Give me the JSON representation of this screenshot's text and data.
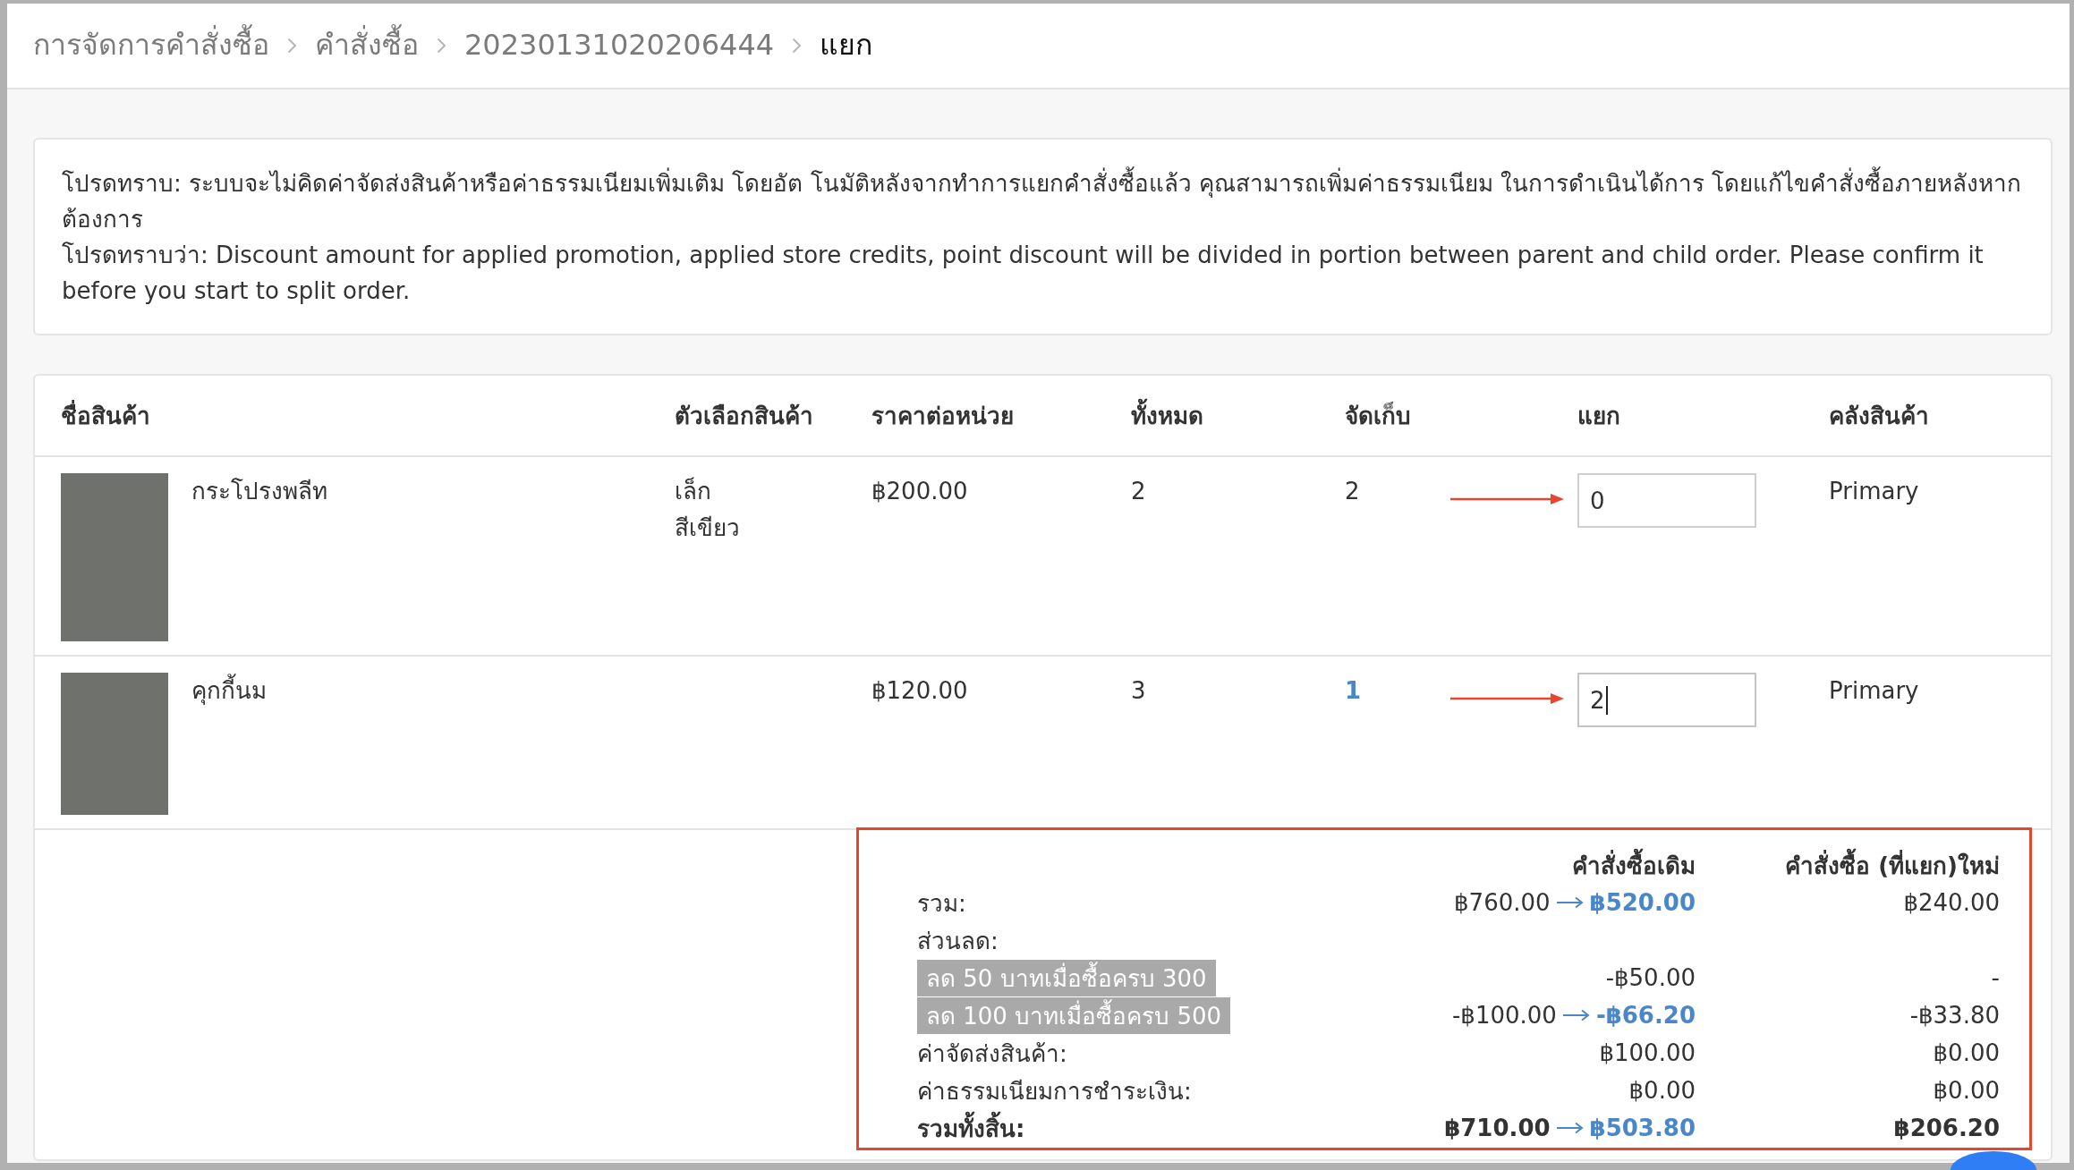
{
  "breadcrumb": [
    {
      "label": "การจัดการคำสั่งซื้อ",
      "current": false
    },
    {
      "label": "คำสั่งซื้อ",
      "current": false
    },
    {
      "label": "20230131020206444",
      "current": false
    },
    {
      "label": "แยก",
      "current": true
    }
  ],
  "notice": [
    "โปรดทราบ: ระบบจะไม่คิดค่าจัดส่งสินค้าหรือค่าธรรมเนียมเพิ่มเติม โดยอัต โนมัติหลังจากทำการแยกคำสั่งซื้อแล้ว คุณสามารถเพิ่มค่าธรรมเนียม ในการดำเนินได้การ โดยแก้ไขคำสั่งซื้อภายหลังหากต้องการ",
    "โปรดทราบว่า: Discount amount for applied promotion, applied store credits, point discount will be divided in portion between parent and child order. Please confirm it before you start to split order."
  ],
  "table": {
    "columns": [
      "ชื่อสินค้า",
      "ตัวเลือกสินค้า",
      "ราคาต่อหน่วย",
      "ทั้งหมด",
      "จัดเก็บ",
      "แยก",
      "คลังสินค้า"
    ],
    "rows": [
      {
        "name": "กระโปรงพลีท",
        "options": [
          "เล็ก",
          "สีเขียว"
        ],
        "price": "฿200.00",
        "total": "2",
        "stored": "2",
        "stored_link": false,
        "split": "0",
        "focused": false,
        "warehouse": "Primary"
      },
      {
        "name": "คุกกี้นม",
        "price": "฿120.00",
        "total": "3",
        "stored": "1",
        "stored_link": true,
        "split": "2",
        "focused": true,
        "warehouse": "Primary"
      }
    ]
  },
  "summary": {
    "columns": [
      "คำสั่งซื้อเดิม",
      "คำสั่งซื้อ (ที่แยก)ใหม่"
    ],
    "lines": [
      {
        "kind": "line",
        "label": "รวม:",
        "original": "฿760.00",
        "adjusted": "฿520.00",
        "new": "฿240.00"
      },
      {
        "kind": "heading",
        "label": "ส่วนลด:"
      },
      {
        "kind": "discount",
        "label": "ลด 50 บาทเมื่อซื้อครบ 300",
        "original": "-฿50.00",
        "new": "-"
      },
      {
        "kind": "discount",
        "label": "ลด 100 บาทเมื่อซื้อครบ 500",
        "original": "-฿100.00",
        "adjusted": "-฿66.20",
        "new": "-฿33.80"
      },
      {
        "kind": "line",
        "label": "ค่าจัดส่งสินค้า:",
        "original": "฿100.00",
        "new": "฿0.00"
      },
      {
        "kind": "line",
        "label": "ค่าธรรมเนียมการชำระเงิน:",
        "original": "฿0.00",
        "new": "฿0.00"
      },
      {
        "kind": "total",
        "label": "รวมทั้งสิ้น:",
        "original": "฿710.00",
        "adjusted": "฿503.80",
        "new": "฿206.20"
      }
    ]
  }
}
